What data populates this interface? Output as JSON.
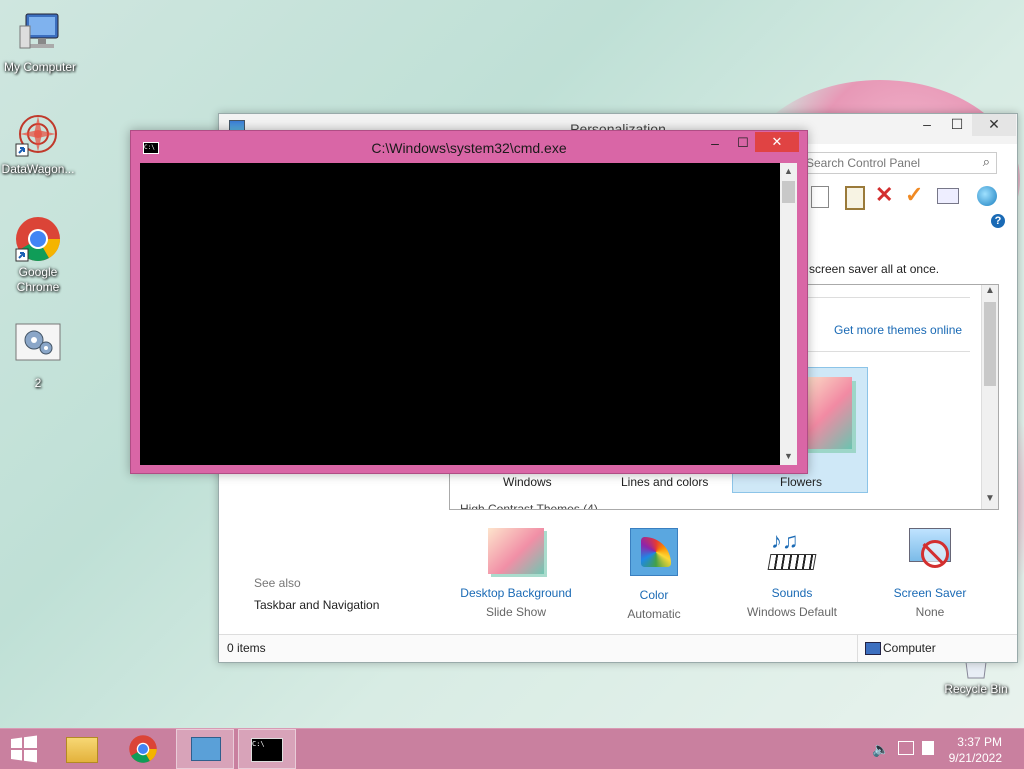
{
  "desktop": {
    "icons": [
      {
        "label": "My Computer"
      },
      {
        "label": "DataWagon..."
      },
      {
        "label": "Google Chrome"
      },
      {
        "label": "2"
      },
      {
        "label": "Recycle Bin"
      }
    ]
  },
  "personalization": {
    "title": "Personalization",
    "search_placeholder": "Search Control Panel",
    "description_fragment": "d screen saver all at once.",
    "get_more_themes": "Get more themes online",
    "themes": [
      {
        "label": "Windows"
      },
      {
        "label": "Lines and colors"
      },
      {
        "label": "Flowers"
      }
    ],
    "high_contrast_partial": "High Contrast Themes (4)",
    "see_also": {
      "heading": "See also",
      "link": "Taskbar and Navigation"
    },
    "bottom": [
      {
        "title": "Desktop Background",
        "sub": "Slide Show"
      },
      {
        "title": "Color",
        "sub": "Automatic"
      },
      {
        "title": "Sounds",
        "sub": "Windows Default"
      },
      {
        "title": "Screen Saver",
        "sub": "None"
      }
    ],
    "status": {
      "items": "0 items",
      "location": "Computer"
    }
  },
  "cmd": {
    "title": "C:\\Windows\\system32\\cmd.exe",
    "icon_text": "C:\\"
  },
  "taskbar": {
    "time": "3:37 PM",
    "date": "9/21/2022"
  },
  "colors": {
    "accent": "#d966a6",
    "taskbar": "#c9809f",
    "link": "#1a6ab5"
  }
}
